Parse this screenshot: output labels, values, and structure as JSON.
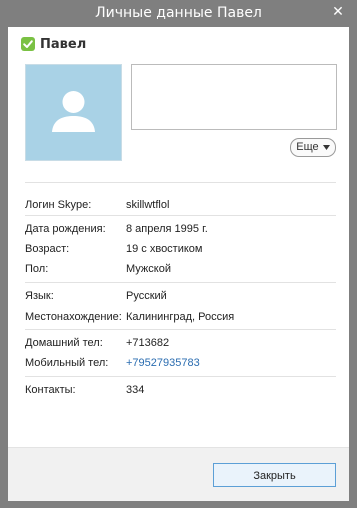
{
  "window": {
    "title": "Личные данные Павел",
    "close_symbol": "✕"
  },
  "profile": {
    "name": "Павел",
    "status_icon": "online-check-icon",
    "status_color": "#7ac143",
    "avatar_color": "#a9d2e6",
    "avatar_icon": "person-silhouette-icon",
    "mood_text": "",
    "more_label": "Еще"
  },
  "details": {
    "skype_login": {
      "label": "Логин Skype:",
      "value": "skillwtflol"
    },
    "birth_date": {
      "label": "Дата рождения:",
      "value": "8 апреля 1995 г."
    },
    "age": {
      "label": "Возраст:",
      "value": "19 с хвостиком"
    },
    "gender": {
      "label": "Пол:",
      "value": "Мужской"
    },
    "language": {
      "label": "Язык:",
      "value": "Русский"
    },
    "location": {
      "label": "Местонахождение:",
      "value": "Калининград, Россия"
    },
    "home_phone": {
      "label": "Домашний тел:",
      "value": "+713682"
    },
    "mobile_phone": {
      "label": "Мобильный тел:",
      "value": "+79527935783"
    },
    "contacts": {
      "label": "Контакты:",
      "value": "334"
    }
  },
  "footer": {
    "close_label": "Закрыть"
  },
  "colors": {
    "titlebar": "#7f7f7f",
    "link": "#2a6cb0",
    "button_border": "#5c9fd6"
  }
}
